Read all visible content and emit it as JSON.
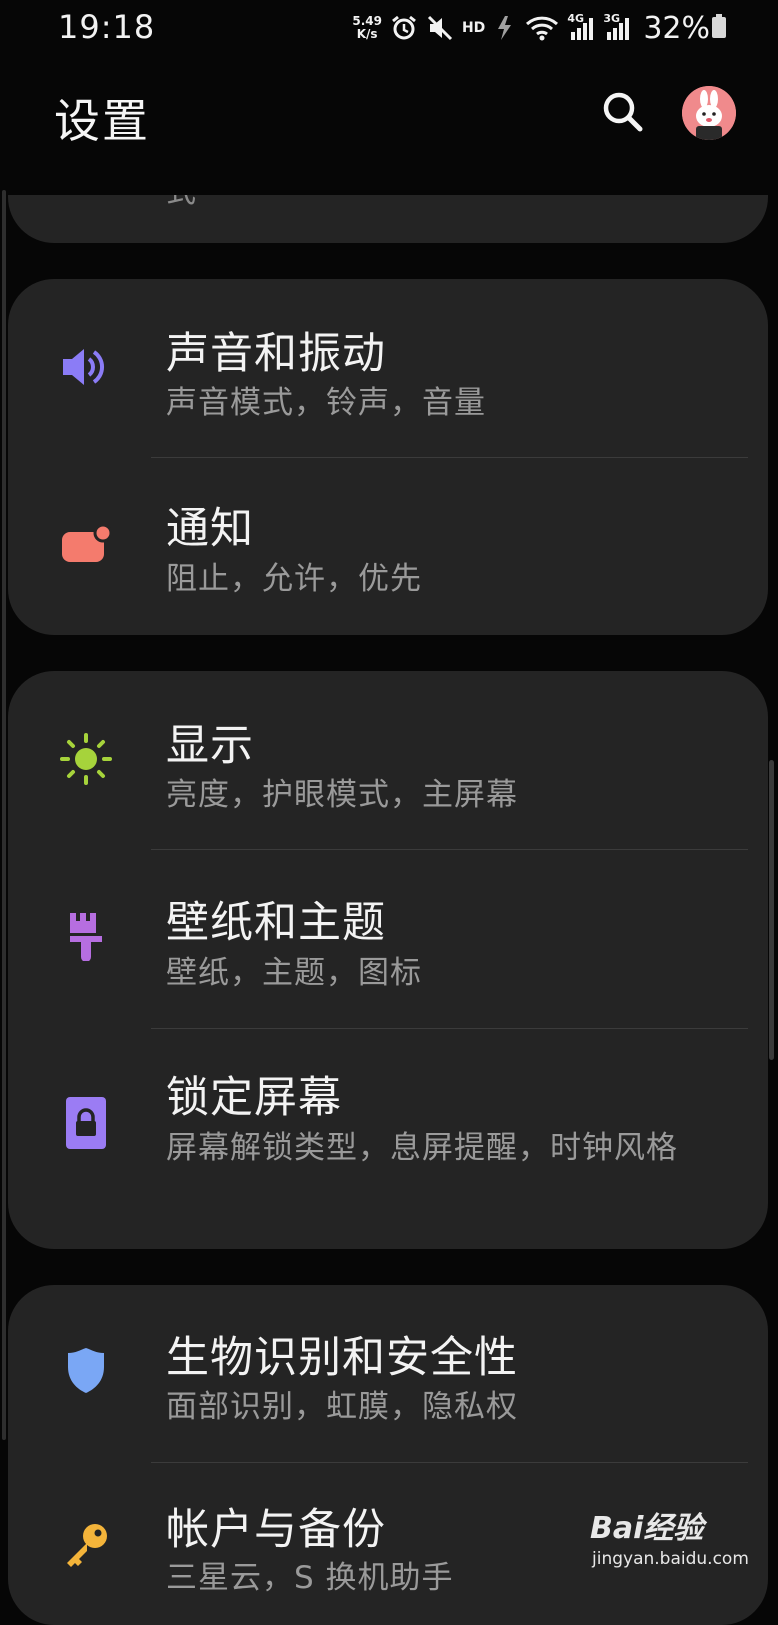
{
  "status_bar": {
    "time": "19:18",
    "net_speed_value": "5.49",
    "net_speed_unit": "K/s",
    "hd_label": "HD",
    "signal_4g": "4G",
    "signal_3g": "3G",
    "battery_percent": "32%",
    "icons": [
      "alarm-icon",
      "mute-icon",
      "data-transfer-icon",
      "wifi-icon",
      "signal-4g-icon",
      "signal-3g-icon",
      "battery-icon"
    ]
  },
  "header": {
    "title": "设置",
    "search_icon": "search-icon",
    "avatar_icon": "avatar"
  },
  "partial_item": {
    "clipped_text": "式"
  },
  "groups": [
    {
      "items": [
        {
          "title": "声音和振动",
          "subtitle": "声音模式，铃声，音量",
          "icon": "speaker-icon",
          "icon_color": "#8b7cf6"
        },
        {
          "title": "通知",
          "subtitle": "阻止，允许，优先",
          "icon": "notification-icon",
          "icon_color": "#f47b6d"
        }
      ]
    },
    {
      "items": [
        {
          "title": "显示",
          "subtitle": "亮度，护眼模式，主屏幕",
          "icon": "sun-icon",
          "icon_color": "#a6d33b"
        },
        {
          "title": "壁纸和主题",
          "subtitle": "壁纸，主题，图标",
          "icon": "brush-icon",
          "icon_color": "#b66ee0"
        },
        {
          "title": "锁定屏幕",
          "subtitle": "屏幕解锁类型，息屏提醒，时钟风格",
          "icon": "lock-icon",
          "icon_color": "#9b7cf4"
        }
      ]
    },
    {
      "items": [
        {
          "title": "生物识别和安全性",
          "subtitle": "面部识别，虹膜，隐私权",
          "icon": "shield-icon",
          "icon_color": "#7aa7f5"
        },
        {
          "title": "帐户与备份",
          "subtitle": "三星云，S 换机助手",
          "icon": "key-icon",
          "icon_color": "#f4b43a"
        }
      ]
    }
  ],
  "watermark": {
    "logo": "Bai经验",
    "site": "jingyan.baidu.com"
  }
}
